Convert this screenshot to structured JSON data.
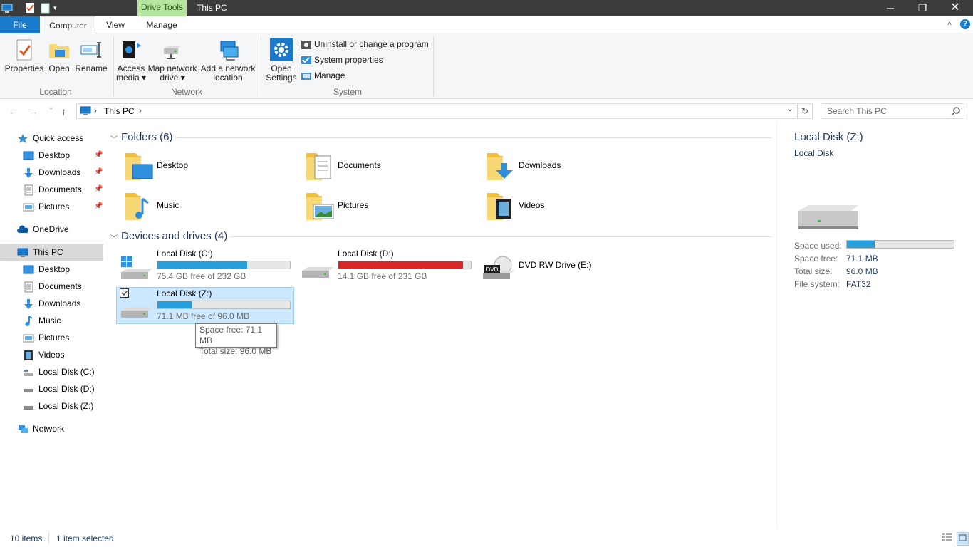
{
  "titlebar": {
    "context_tab": "Drive Tools",
    "window_title": "This PC",
    "minimize": "─",
    "maximize": "❐",
    "close": "✕"
  },
  "tabs": {
    "file": "File",
    "computer": "Computer",
    "view": "View",
    "manage": "Manage",
    "collapse": "^",
    "help": "?"
  },
  "ribbon": {
    "location": {
      "label": "Location",
      "properties": "Properties",
      "open": "Open",
      "rename": "Rename"
    },
    "network": {
      "label": "Network",
      "access_media_1": "Access",
      "access_media_2": "media ▾",
      "map_drive_1": "Map network",
      "map_drive_2": "drive ▾",
      "add_location_1": "Add a network",
      "add_location_2": "location"
    },
    "system": {
      "label": "System",
      "open_settings_1": "Open",
      "open_settings_2": "Settings",
      "uninstall": "Uninstall or change a program",
      "system_properties": "System properties",
      "manage": "Manage"
    }
  },
  "address": {
    "back": "←",
    "forward": "→",
    "recent": "⌄",
    "up": "↑",
    "crumb_sep": "›",
    "crumb": "This PC",
    "crumb_sep2": "›",
    "dropdown": "⌄",
    "refresh": "↻",
    "search_placeholder": "Search This PC"
  },
  "nav": {
    "quick_access": "Quick access",
    "qa_desktop": "Desktop",
    "qa_downloads": "Downloads",
    "qa_documents": "Documents",
    "qa_pictures": "Pictures",
    "onedrive": "OneDrive",
    "thispc": "This PC",
    "pc_desktop": "Desktop",
    "pc_documents": "Documents",
    "pc_downloads": "Downloads",
    "pc_music": "Music",
    "pc_pictures": "Pictures",
    "pc_videos": "Videos",
    "pc_c": "Local Disk (C:)",
    "pc_d": "Local Disk (D:)",
    "pc_z": "Local Disk (Z:)",
    "network": "Network"
  },
  "folders": {
    "heading": "Folders (6)",
    "items": [
      "Desktop",
      "Documents",
      "Downloads",
      "Music",
      "Pictures",
      "Videos"
    ]
  },
  "drives": {
    "heading": "Devices and drives (4)",
    "c": {
      "name": "Local Disk (C:)",
      "free": "75.4 GB free of 232 GB",
      "used_fraction": 0.675
    },
    "d": {
      "name": "Local Disk (D:)",
      "free": "14.1 GB free of 231 GB",
      "used_fraction": 0.939
    },
    "e": {
      "name": "DVD RW Drive (E:)"
    },
    "z": {
      "name": "Local Disk (Z:)",
      "free": "71.1 MB free of 96.0 MB",
      "used_fraction": 0.26
    }
  },
  "tooltip": {
    "line1": "Space free: 71.1 MB",
    "line2": "Total size: 96.0 MB"
  },
  "details": {
    "title": "Local Disk (Z:)",
    "subtitle": "Local Disk",
    "space_used_label": "Space used:",
    "space_used_fraction": 0.26,
    "space_free_label": "Space free:",
    "space_free": "71.1 MB",
    "total_size_label": "Total size:",
    "total_size": "96.0 MB",
    "file_system_label": "File system:",
    "file_system": "FAT32"
  },
  "status": {
    "items": "10 items",
    "selected": "1 item selected"
  },
  "colors": {
    "accent": "#1979ca",
    "bar_normal": "#26a0da",
    "bar_full": "#da2626",
    "selection": "#cce8ff"
  }
}
